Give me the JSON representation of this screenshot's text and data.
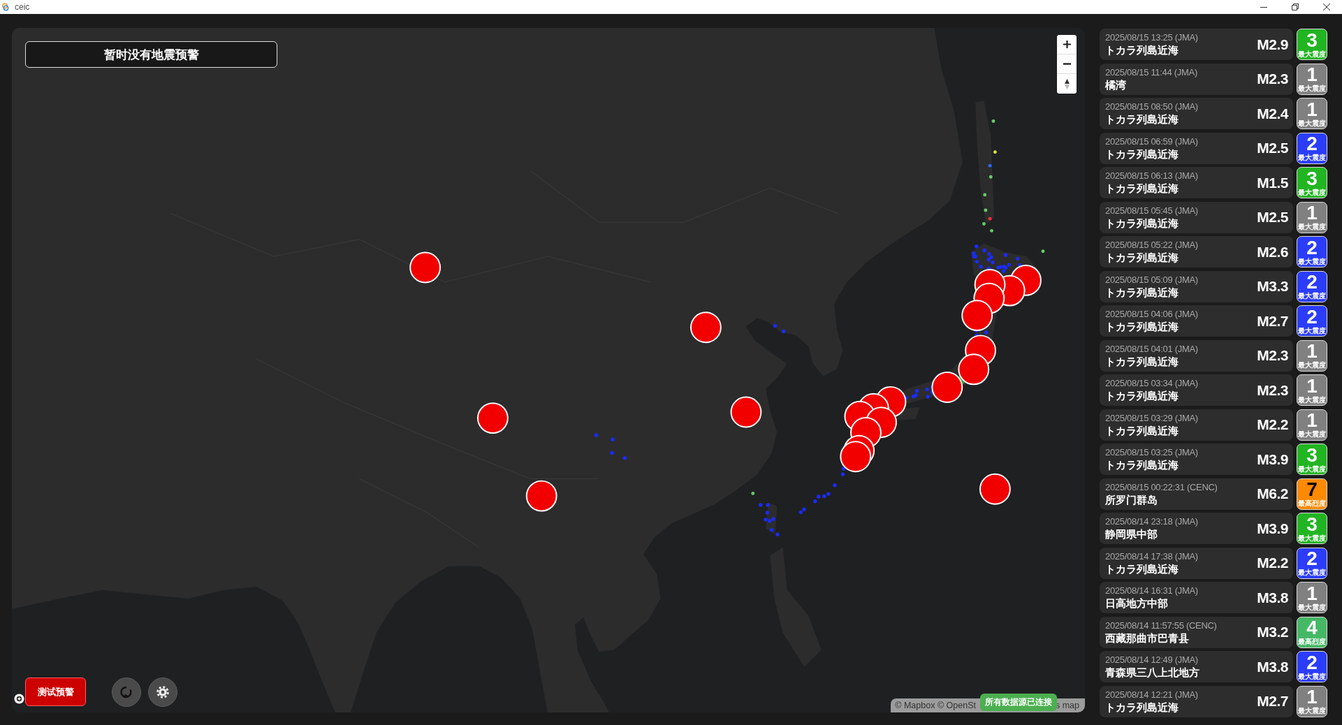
{
  "window": {
    "title": "ceic"
  },
  "alert_banner": {
    "text": "暂时没有地震预警"
  },
  "test_button": {
    "label": "测试预警"
  },
  "attribution": {
    "visible_parts": [
      "© Mapbox © OpenSt",
      "s map"
    ]
  },
  "status_toast": {
    "text": "所有数据源已连接"
  },
  "quakes": [
    {
      "time": "2025/08/15 13:25 (JMA)",
      "place": "トカラ列島近海",
      "magnitude": "M2.9",
      "intensity": "3",
      "intensity_label": "最大震度",
      "color": "#22b522"
    },
    {
      "time": "2025/08/15 11:44 (JMA)",
      "place": "橘湾",
      "magnitude": "M2.3",
      "intensity": "1",
      "intensity_label": "最大震度",
      "color": "#808080"
    },
    {
      "time": "2025/08/15 08:50 (JMA)",
      "place": "トカラ列島近海",
      "magnitude": "M2.4",
      "intensity": "1",
      "intensity_label": "最大震度",
      "color": "#808080"
    },
    {
      "time": "2025/08/15 06:59 (JMA)",
      "place": "トカラ列島近海",
      "magnitude": "M2.5",
      "intensity": "2",
      "intensity_label": "最大震度",
      "color": "#2b3dfa"
    },
    {
      "time": "2025/08/15 06:13 (JMA)",
      "place": "トカラ列島近海",
      "magnitude": "M1.5",
      "intensity": "3",
      "intensity_label": "最大震度",
      "color": "#22b522"
    },
    {
      "time": "2025/08/15 05:45 (JMA)",
      "place": "トカラ列島近海",
      "magnitude": "M2.5",
      "intensity": "1",
      "intensity_label": "最大震度",
      "color": "#808080"
    },
    {
      "time": "2025/08/15 05:22 (JMA)",
      "place": "トカラ列島近海",
      "magnitude": "M2.6",
      "intensity": "2",
      "intensity_label": "最大震度",
      "color": "#2b3dfa"
    },
    {
      "time": "2025/08/15 05:09 (JMA)",
      "place": "トカラ列島近海",
      "magnitude": "M3.3",
      "intensity": "2",
      "intensity_label": "最大震度",
      "color": "#2b3dfa"
    },
    {
      "time": "2025/08/15 04:06 (JMA)",
      "place": "トカラ列島近海",
      "magnitude": "M2.7",
      "intensity": "2",
      "intensity_label": "最大震度",
      "color": "#2b3dfa"
    },
    {
      "time": "2025/08/15 04:01 (JMA)",
      "place": "トカラ列島近海",
      "magnitude": "M2.3",
      "intensity": "1",
      "intensity_label": "最大震度",
      "color": "#808080"
    },
    {
      "time": "2025/08/15 03:34 (JMA)",
      "place": "トカラ列島近海",
      "magnitude": "M2.3",
      "intensity": "1",
      "intensity_label": "最大震度",
      "color": "#808080"
    },
    {
      "time": "2025/08/15 03:29 (JMA)",
      "place": "トカラ列島近海",
      "magnitude": "M2.2",
      "intensity": "1",
      "intensity_label": "最大震度",
      "color": "#808080"
    },
    {
      "time": "2025/08/15 03:25 (JMA)",
      "place": "トカラ列島近海",
      "magnitude": "M3.9",
      "intensity": "3",
      "intensity_label": "最大震度",
      "color": "#22b522"
    },
    {
      "time": "2025/08/15 00:22:31 (CENC)",
      "place": "所罗门群岛",
      "magnitude": "M6.2",
      "intensity": "7",
      "intensity_label": "最高烈度",
      "color": "#ff8a00"
    },
    {
      "time": "2025/08/14 23:18 (JMA)",
      "place": "静岡県中部",
      "magnitude": "M3.9",
      "intensity": "3",
      "intensity_label": "最大震度",
      "color": "#22b522"
    },
    {
      "time": "2025/08/14 17:38 (JMA)",
      "place": "トカラ列島近海",
      "magnitude": "M2.2",
      "intensity": "2",
      "intensity_label": "最大震度",
      "color": "#2b3dfa"
    },
    {
      "time": "2025/08/14 16:31 (JMA)",
      "place": "日高地方中部",
      "magnitude": "M3.8",
      "intensity": "1",
      "intensity_label": "最大震度",
      "color": "#808080"
    },
    {
      "time": "2025/08/14 11:57:55 (CENC)",
      "place": "西藏那曲市巴青县",
      "magnitude": "M3.2",
      "intensity": "4",
      "intensity_label": "最高烈度",
      "color": "#45b866"
    },
    {
      "time": "2025/08/14 12:49 (JMA)",
      "place": "青森県三八上北地方",
      "magnitude": "M3.8",
      "intensity": "2",
      "intensity_label": "最大震度",
      "color": "#2b3dfa"
    },
    {
      "time": "2025/08/14 12:21 (JMA)",
      "place": "トカラ列島近海",
      "magnitude": "M2.7",
      "intensity": "1",
      "intensity_label": "最大震度",
      "color": "#808080"
    }
  ]
}
